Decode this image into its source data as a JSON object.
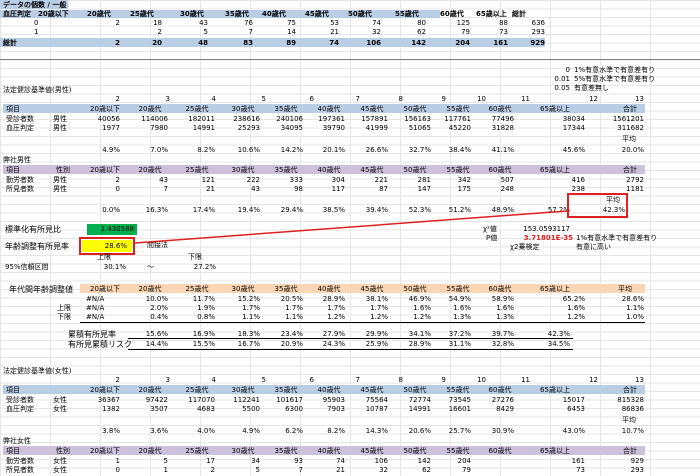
{
  "colors": {
    "header_blue": "#b9cde5",
    "purple": "#ccc0da",
    "tan": "#fcd5b4",
    "green": "#00b050",
    "yellow": "#ffff00",
    "red": "#e02020"
  },
  "cross": {
    "title": "データの個数 / 一般",
    "corner": "血圧判定",
    "headers": [
      "20歳以下",
      "20歳代",
      "25歳代",
      "30歳代",
      "35歳代",
      "40歳代",
      "45歳代",
      "50歳代",
      "55歳代",
      "60歳代",
      "65歳以上",
      "総計"
    ],
    "rows": [
      {
        "label": "0",
        "values": [
          "2",
          "18",
          "43",
          "76",
          "75",
          "53",
          "74",
          "80",
          "125",
          "88",
          "636"
        ]
      },
      {
        "label": "1",
        "values": [
          "",
          "2",
          "5",
          "7",
          "14",
          "21",
          "32",
          "62",
          "79",
          "73",
          "293"
        ]
      }
    ],
    "total": {
      "label": "総計",
      "values": [
        "2",
        "20",
        "48",
        "83",
        "89",
        "74",
        "106",
        "142",
        "204",
        "161",
        "929"
      ]
    }
  },
  "legend": [
    {
      "p": "0",
      "text": "1%有意水準で有意差有り"
    },
    {
      "p": "0.01",
      "text": "5%有意水準で有意差有り"
    },
    {
      "p": "0.05",
      "text": "有意差無し"
    }
  ],
  "male": {
    "section_title": "法定健診基準値(男性)",
    "col_numbers": [
      "2",
      "3",
      "4",
      "5",
      "6",
      "7",
      "8",
      "9",
      "10",
      "11",
      "12",
      "13"
    ],
    "headers": {
      "item": "項目",
      "ages": [
        "20歳以下",
        "20歳代",
        "25歳代",
        "30歳代",
        "35歳代",
        "40歳代",
        "45歳代",
        "50歳代",
        "55歳代",
        "60歳代",
        "65歳以上"
      ],
      "total": "合計"
    },
    "rows": [
      {
        "label": "受診者数",
        "sex": "男性",
        "values": [
          "40056",
          "114006",
          "182011",
          "238616",
          "240106",
          "197361",
          "157891",
          "156163",
          "117761",
          "77496",
          "38034",
          "1561201"
        ]
      },
      {
        "label": "血圧判定",
        "sex": "男性",
        "values": [
          "1977",
          "7980",
          "14991",
          "25293",
          "34095",
          "39790",
          "41999",
          "51065",
          "45220",
          "31828",
          "17344",
          "311682"
        ]
      }
    ],
    "pct_row": [
      "4.9%",
      "7.0%",
      "8.2%",
      "10.6%",
      "14.2%",
      "20.1%",
      "26.6%",
      "32.7%",
      "38.4%",
      "41.1%",
      "45.6%",
      "20.0%"
    ],
    "avg_label": "平均",
    "firm_title": "弊社男性",
    "firm_headers": {
      "item": "項目",
      "sex": "性別",
      "ages": [
        "20歳以下",
        "20歳代",
        "25歳代",
        "30歳代",
        "35歳代",
        "40歳代",
        "45歳代",
        "50歳代",
        "55歳代",
        "60歳代",
        "65歳以上"
      ],
      "total": "合計"
    },
    "firm_rows": [
      {
        "label": "勤労者数",
        "sex": "男性",
        "values": [
          "2",
          "43",
          "121",
          "222",
          "333",
          "304",
          "221",
          "281",
          "342",
          "507",
          "416",
          "2792"
        ]
      },
      {
        "label": "所見者数",
        "sex": "男性",
        "values": [
          "0",
          "7",
          "21",
          "43",
          "98",
          "117",
          "87",
          "147",
          "175",
          "248",
          "238",
          "1181"
        ]
      }
    ],
    "firm_pct": [
      "0.0%",
      "16.3%",
      "17.4%",
      "19.4%",
      "29.4%",
      "38.5%",
      "39.4%",
      "52.3%",
      "51.2%",
      "48.9%",
      "57.2%",
      "42.3%"
    ],
    "firm_avg_label": "平均"
  },
  "stats": {
    "smr_label": "標準化有所見比",
    "smr_value": "1.430588",
    "age_adj_label": "年齢調整有所見率",
    "age_adj_value": "28.6%",
    "method": "間接法",
    "upper": "上限",
    "lower": "下限",
    "ci_label": "95%信頼区間",
    "ci_low": "30.1%",
    "ci_sep": "〜",
    "ci_high": "27.2%",
    "chi_label": "χ²値",
    "chi_value": "153.0593117",
    "p_label": "P値",
    "p_value": "3.71801E-35",
    "test_label": "χ2乗検定",
    "result_text": "1%有意水準で有意差有り",
    "result_text2": "有意に高い"
  },
  "age_adj": {
    "title": "年代間年齢調整値",
    "headers": [
      "20歳以下",
      "20歳代",
      "25歳代",
      "30歳代",
      "35歳代",
      "40歳代",
      "45歳代",
      "50歳代",
      "55歳代",
      "60歳代",
      "65歳以上",
      "平均"
    ],
    "rows": [
      {
        "label": "",
        "values": [
          "#N/A",
          "10.0%",
          "11.7%",
          "15.2%",
          "20.5%",
          "28.9%",
          "38.1%",
          "46.9%",
          "54.9%",
          "58.9%",
          "65.2%",
          "28.6%"
        ]
      },
      {
        "label": "上限",
        "values": [
          "#N/A",
          "2.0%",
          "1.9%",
          "1.7%",
          "1.7%",
          "1.7%",
          "1.7%",
          "1.6%",
          "1.6%",
          "1.6%",
          "1.6%",
          "1.1%"
        ]
      },
      {
        "label": "下限",
        "values": [
          "#N/A",
          "0.4%",
          "0.8%",
          "1.1%",
          "1.1%",
          "1.2%",
          "1.2%",
          "1.2%",
          "1.3%",
          "1.3%",
          "1.2%",
          "1.0%"
        ]
      }
    ],
    "cum_label": "累積有所見率",
    "cum_values": [
      "15.6%",
      "16.9%",
      "18.3%",
      "23.4%",
      "27.9%",
      "29.9%",
      "34.1%",
      "37.2%",
      "39.7%",
      "42.3%"
    ],
    "risk_label": "有所見累積リスク",
    "risk_values": [
      "14.4%",
      "15.5%",
      "16.7%",
      "20.9%",
      "24.3%",
      "25.9%",
      "28.9%",
      "31.1%",
      "32.8%",
      "34.5%"
    ]
  },
  "female": {
    "section_title": "法定健診基準値(女性)",
    "col_numbers": [
      "2",
      "3",
      "4",
      "5",
      "6",
      "7",
      "8",
      "9",
      "10",
      "11",
      "12",
      "13"
    ],
    "headers": {
      "item": "項目",
      "ages": [
        "20歳以下",
        "20歳代",
        "25歳代",
        "30歳代",
        "35歳代",
        "40歳代",
        "45歳代",
        "50歳代",
        "55歳代",
        "60歳代",
        "65歳以上"
      ],
      "total": "合計"
    },
    "rows": [
      {
        "label": "受診者数",
        "sex": "女性",
        "values": [
          "36367",
          "97422",
          "117070",
          "112241",
          "101617",
          "95903",
          "75564",
          "72774",
          "73545",
          "27276",
          "15017",
          "815328"
        ]
      },
      {
        "label": "血圧判定",
        "sex": "女性",
        "values": [
          "1382",
          "3507",
          "4683",
          "5500",
          "6300",
          "7903",
          "10787",
          "14991",
          "16601",
          "8429",
          "6453",
          "86836"
        ]
      }
    ],
    "pct_row": [
      "3.8%",
      "3.6%",
      "4.0%",
      "4.9%",
      "6.2%",
      "8.2%",
      "14.3%",
      "20.6%",
      "25.7%",
      "30.9%",
      "43.0%",
      "10.7%"
    ],
    "avg_label": "平均",
    "firm_title": "弊社女性",
    "firm_headers": {
      "item": "項目",
      "sex": "性別",
      "ages": [
        "20歳以下",
        "20歳代",
        "25歳代",
        "30歳代",
        "35歳代",
        "40歳代",
        "45歳代",
        "50歳代",
        "55歳代",
        "60歳代",
        "65歳以上"
      ],
      "total": "合計"
    },
    "firm_rows": [
      {
        "label": "勤労者数",
        "sex": "女性",
        "values": [
          "1",
          "5",
          "17",
          "34",
          "93",
          "74",
          "106",
          "142",
          "204",
          "161",
          "929"
        ]
      },
      {
        "label": "所見者数",
        "sex": "女性",
        "values": [
          "0",
          "1",
          "2",
          "5",
          "7",
          "21",
          "32",
          "62",
          "79",
          "73",
          "293"
        ]
      }
    ]
  }
}
